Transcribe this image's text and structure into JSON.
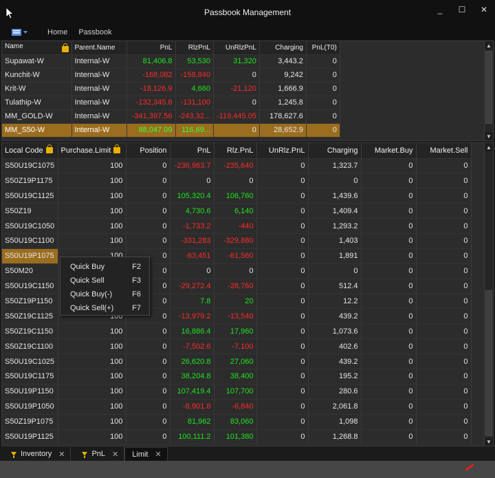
{
  "window": {
    "title": "Passbook Management",
    "controls": [
      "_",
      "☐",
      "✕"
    ]
  },
  "toolbar": {
    "home": "Home",
    "passbook": "Passbook"
  },
  "accounts": {
    "columns": [
      "Name",
      "Parent.Name",
      "PnL",
      "RlzPnL",
      "UnRlzPnL",
      "Charging",
      "PnL(T0)"
    ],
    "rows": [
      [
        "Supawat-W",
        "Internal-W",
        "81,406.8",
        "53,530",
        "31,320",
        "3,443.2",
        "0"
      ],
      [
        "Kunchit-W",
        "Internal-W",
        "-168,082",
        "-158,840",
        "0",
        "9,242",
        "0"
      ],
      [
        "Krit-W",
        "Internal-W",
        "-18,126.9",
        "4,660",
        "-21,120",
        "1,666.9",
        "0"
      ],
      [
        "Tulathip-W",
        "Internal-W",
        "-132,345.8",
        "-131,100",
        "0",
        "1,245.8",
        "0"
      ],
      [
        "MM_GOLD-W",
        "Internal-W",
        "-341,397.56",
        "-243,32...",
        "-119,445.05",
        "178,627.6",
        "0"
      ],
      [
        "MM_S50-W",
        "Internal-W",
        "88,047.09",
        "116,69...",
        "0",
        "28,652.9",
        "0"
      ]
    ]
  },
  "positions": {
    "columns": [
      "Local Code",
      "Purchase.Limit",
      "Position",
      "PnL",
      "Rlz.PnL",
      "UnRlz.PnL",
      "Charging",
      "Market.Buy",
      "Market.Sell"
    ],
    "rows": [
      [
        "S50U19C1075",
        "100",
        "0",
        "-236,963.7",
        "-235,640",
        "0",
        "1,323.7",
        "0",
        "0"
      ],
      [
        "S50Z19P1175",
        "100",
        "0",
        "0",
        "0",
        "0",
        "0",
        "0",
        "0"
      ],
      [
        "S50U19C1125",
        "100",
        "0",
        "105,320.4",
        "106,760",
        "0",
        "1,439.6",
        "0",
        "0"
      ],
      [
        "S50Z19",
        "100",
        "0",
        "4,730.6",
        "6,140",
        "0",
        "1,409.4",
        "0",
        "0"
      ],
      [
        "S50U19C1050",
        "100",
        "0",
        "-1,733.2",
        "-440",
        "0",
        "1,293.2",
        "0",
        "0"
      ],
      [
        "S50U19C1100",
        "100",
        "0",
        "-331,283",
        "-329,880",
        "0",
        "1,403",
        "0",
        "0"
      ],
      [
        "S50U19P1075",
        "100",
        "0",
        "-63,451",
        "-61,560",
        "0",
        "1,891",
        "0",
        "0"
      ],
      [
        "S50M20",
        "",
        "0",
        "0",
        "0",
        "0",
        "0",
        "0",
        "0"
      ],
      [
        "S50U19C1150",
        "",
        "0",
        "-29,272.4",
        "-28,760",
        "0",
        "512.4",
        "0",
        "0"
      ],
      [
        "S50Z19P1150",
        "",
        "0",
        "7.8",
        "20",
        "0",
        "12.2",
        "0",
        "0"
      ],
      [
        "S50Z19C1125",
        "100",
        "0",
        "-13,979.2",
        "-13,540",
        "0",
        "439.2",
        "0",
        "0"
      ],
      [
        "S50Z19C1150",
        "100",
        "0",
        "16,886.4",
        "17,960",
        "0",
        "1,073.6",
        "0",
        "0"
      ],
      [
        "S50Z19C1100",
        "100",
        "0",
        "-7,502.6",
        "-7,100",
        "0",
        "402.6",
        "0",
        "0"
      ],
      [
        "S50U19C1025",
        "100",
        "0",
        "26,620.8",
        "27,060",
        "0",
        "439.2",
        "0",
        "0"
      ],
      [
        "S50U19C1175",
        "100",
        "0",
        "38,204.8",
        "38,400",
        "0",
        "195.2",
        "0",
        "0"
      ],
      [
        "S50U19P1150",
        "100",
        "0",
        "107,419.4",
        "107,700",
        "0",
        "280.6",
        "0",
        "0"
      ],
      [
        "S50U19P1050",
        "100",
        "0",
        "-8,901.8",
        "-6,840",
        "0",
        "2,061.8",
        "0",
        "0"
      ],
      [
        "S50Z19P1075",
        "100",
        "0",
        "81,962",
        "83,060",
        "0",
        "1,098",
        "0",
        "0"
      ],
      [
        "S50U19P1125",
        "100",
        "0",
        "100,111.2",
        "101,380",
        "0",
        "1,268.8",
        "0",
        "0"
      ]
    ]
  },
  "context_menu": [
    {
      "label": "Quick Buy",
      "key": "F2"
    },
    {
      "label": "Quick Sell",
      "key": "F3"
    },
    {
      "label": "Quick Buy(-)",
      "key": "F6"
    },
    {
      "label": "Quick Sell(+)",
      "key": "F7"
    }
  ],
  "tabs": [
    {
      "label": "Inventory",
      "filter": true
    },
    {
      "label": "PnL",
      "filter": true
    },
    {
      "label": "Limit",
      "filter": false
    }
  ],
  "colors": {
    "selection": "#9b6d1e",
    "positive": "#1fe51f",
    "negative": "#ff2a2a",
    "lock": "#e8b100"
  }
}
